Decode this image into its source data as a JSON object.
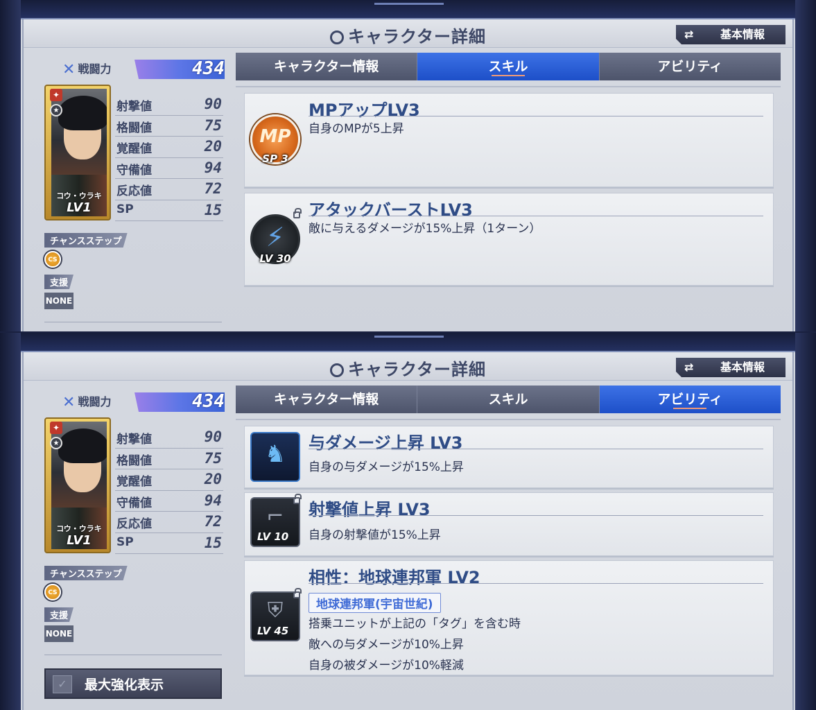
{
  "title": "キャラクター詳細",
  "basic_info_button": "基本情報",
  "power_label": "戦闘力",
  "power_value": "434",
  "character": {
    "name": "コウ・ウラキ",
    "level": "LV1"
  },
  "stats": [
    {
      "label": "射撃値",
      "value": "90"
    },
    {
      "label": "格闘値",
      "value": "75"
    },
    {
      "label": "覚醒値",
      "value": "20"
    },
    {
      "label": "守備値",
      "value": "94"
    },
    {
      "label": "反応値",
      "value": "72"
    },
    {
      "label": "SP",
      "value": "15"
    }
  ],
  "chance_step_label": "チャンスステップ",
  "cs_badge": "CS",
  "support_label": "支援",
  "support_value": "NONE",
  "max_display_button": "最大強化表示",
  "tabs": [
    "キャラクター情報",
    "スキル",
    "アビリティ"
  ],
  "panel1_active_tab": "スキル",
  "panel2_active_tab": "アビリティ",
  "skills": [
    {
      "title": "MPアップLV3",
      "desc": "自身のMPが5上昇",
      "icon": "mp-icon",
      "icon_text": "MP",
      "cap": "SP 3"
    },
    {
      "title": "アタックバーストLV3",
      "desc": "敵に与えるダメージが15%上昇（1ターン）",
      "icon": "lightning-icon",
      "cap": "LV 30",
      "locked": true
    }
  ],
  "abilities": [
    {
      "title": "与ダメージ上昇 LV3",
      "desc": "自身の与ダメージが15%上昇",
      "icon": "pilot-damage-icon"
    },
    {
      "title": "射撃値上昇 LV3",
      "desc": "自身の射撃値が15%上昇",
      "icon": "rifle-icon",
      "cap": "LV 10",
      "locked": true
    },
    {
      "title": "相性：地球連邦軍 LV2",
      "tag": "地球連邦軍(宇宙世紀)",
      "desc_lines": [
        "搭乗ユニットが上記の「タグ」を含む時",
        "敵への与ダメージが10%上昇",
        "自身の被ダメージが10%軽減"
      ],
      "icon": "faction-icon",
      "cap": "LV 45",
      "locked": true
    }
  ],
  "colors": {
    "active_tab": "#1d4fc8",
    "tab_bar": "#4d546b",
    "title_text": "#2f4c86",
    "tag_text": "#3f6bd6"
  }
}
